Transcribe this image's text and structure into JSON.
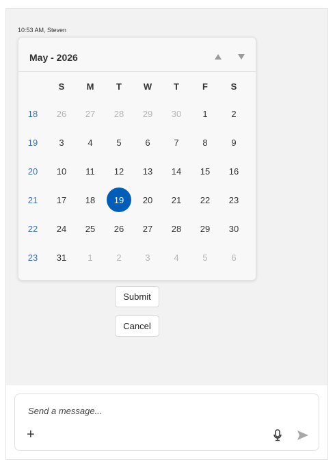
{
  "message": {
    "meta": "10:53 AM, Steven"
  },
  "calendar": {
    "title": "May - 2026",
    "weekday_headers": [
      "S",
      "M",
      "T",
      "W",
      "T",
      "F",
      "S"
    ],
    "weeks": [
      {
        "week_no": "18",
        "days": [
          "26",
          "27",
          "28",
          "29",
          "30",
          "1",
          "2"
        ],
        "other_month": [
          true,
          true,
          true,
          true,
          true,
          false,
          false
        ]
      },
      {
        "week_no": "19",
        "days": [
          "3",
          "4",
          "5",
          "6",
          "7",
          "8",
          "9"
        ],
        "other_month": [
          false,
          false,
          false,
          false,
          false,
          false,
          false
        ]
      },
      {
        "week_no": "20",
        "days": [
          "10",
          "11",
          "12",
          "13",
          "14",
          "15",
          "16"
        ],
        "other_month": [
          false,
          false,
          false,
          false,
          false,
          false,
          false
        ]
      },
      {
        "week_no": "21",
        "days": [
          "17",
          "18",
          "19",
          "20",
          "21",
          "22",
          "23"
        ],
        "other_month": [
          false,
          false,
          false,
          false,
          false,
          false,
          false
        ]
      },
      {
        "week_no": "22",
        "days": [
          "24",
          "25",
          "26",
          "27",
          "28",
          "29",
          "30"
        ],
        "other_month": [
          false,
          false,
          false,
          false,
          false,
          false,
          false
        ]
      },
      {
        "week_no": "23",
        "days": [
          "31",
          "1",
          "2",
          "3",
          "4",
          "5",
          "6"
        ],
        "other_month": [
          false,
          true,
          true,
          true,
          true,
          true,
          true
        ]
      }
    ],
    "selected_day": "19",
    "nav_up_icon": "triangle-up-icon",
    "nav_down_icon": "triangle-down-icon"
  },
  "actions": {
    "submit_label": "Submit",
    "cancel_label": "Cancel"
  },
  "composer": {
    "placeholder": "Send a message...",
    "add_icon": "plus-icon",
    "mic_icon": "microphone-icon",
    "send_icon": "send-icon"
  },
  "colors": {
    "accent": "#005eb8",
    "week_number": "#3b6fb6",
    "other_month": "#b5b5b5",
    "chat_background": "#f2f2f2"
  }
}
